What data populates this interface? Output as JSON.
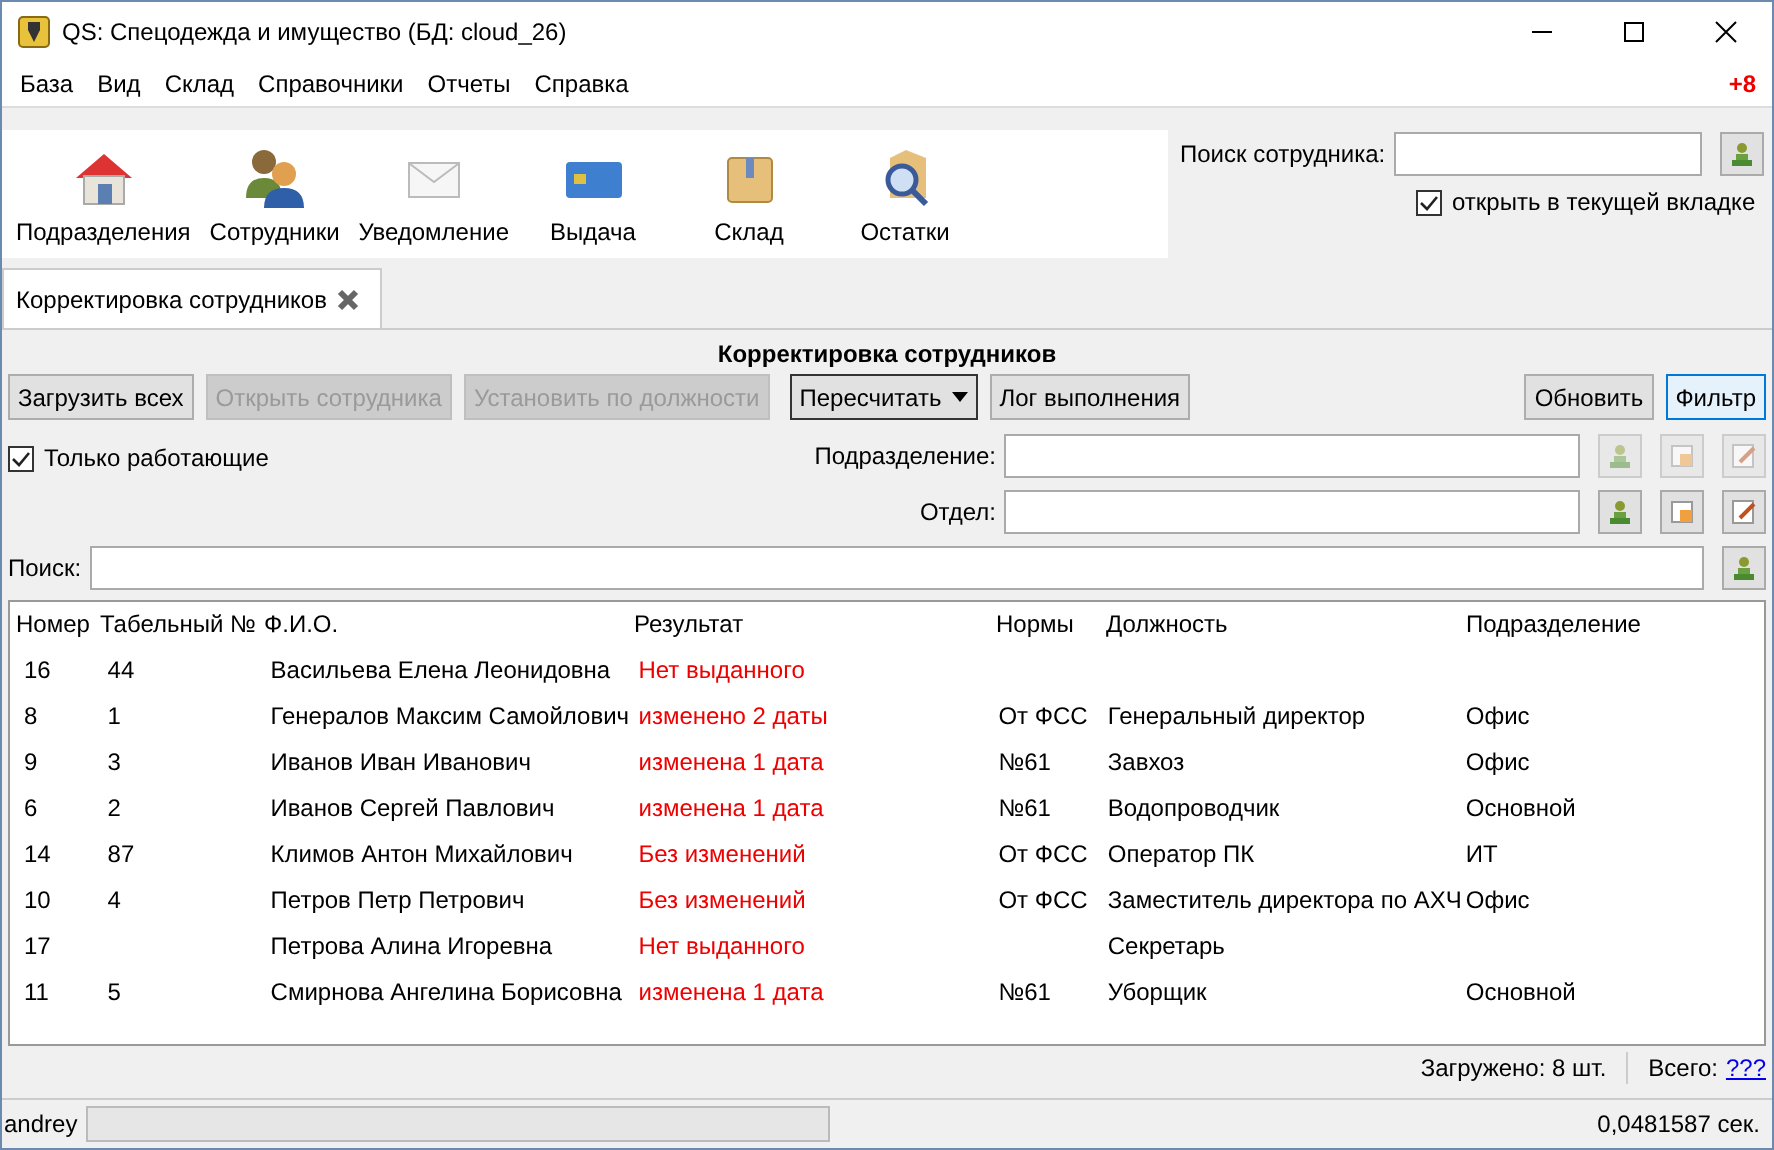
{
  "window": {
    "title": "QS: Спецодежда и имущество (БД: cloud_26)"
  },
  "menu": [
    "База",
    "Вид",
    "Склад",
    "Справочники",
    "Отчеты",
    "Справка"
  ],
  "notification_count": "+8",
  "toolbar": [
    {
      "kind": "house",
      "label": "Подразделения"
    },
    {
      "kind": "people",
      "label": "Сотрудники"
    },
    {
      "kind": "envelope",
      "label": "Уведомление"
    },
    {
      "kind": "card",
      "label": "Выдача"
    },
    {
      "kind": "box",
      "label": "Склад"
    },
    {
      "kind": "magnifier",
      "label": "Остатки"
    }
  ],
  "employee_search": {
    "label": "Поиск сотрудника:",
    "open_in_current_tab": {
      "label": "открыть в текущей вкладке",
      "checked": true
    }
  },
  "tabs": [
    {
      "label": "Корректировка сотрудников",
      "selected": true
    }
  ],
  "panel_title": "Корректировка сотрудников",
  "actions": [
    {
      "label": "Загрузить всех",
      "disabled": false,
      "kind": "plain"
    },
    {
      "label": "Открыть сотрудника",
      "disabled": true,
      "kind": "plain"
    },
    {
      "label": "Установить по должности",
      "disabled": true,
      "kind": "plain"
    },
    {
      "label": "Пересчитать",
      "disabled": false,
      "kind": "dropdown"
    },
    {
      "label": "Лог выполнения",
      "disabled": false,
      "kind": "plain"
    }
  ],
  "right_actions": [
    {
      "label": "Обновить",
      "selected": false
    },
    {
      "label": "Фильтр",
      "selected": true
    }
  ],
  "only_working": {
    "label": "Только работающие",
    "checked": true
  },
  "filters": [
    {
      "label": "Подразделение:",
      "disabled": true
    },
    {
      "label": "Отдел:",
      "disabled": false
    }
  ],
  "search": {
    "label": "Поиск:"
  },
  "table": {
    "columns": [
      "Номер",
      "Табельный №",
      "Ф.И.О.",
      "Результат",
      "Нормы",
      "Должность",
      "Подразделение"
    ],
    "rows": [
      [
        "16",
        "44",
        "Васильева Елена Леонидовна",
        "Нет выданного",
        "",
        "",
        ""
      ],
      [
        "8",
        "1",
        "Генералов Максим Самойлович",
        "изменено 2 даты",
        "От ФСС",
        "Генеральный директор",
        "Офис"
      ],
      [
        "9",
        "3",
        "Иванов Иван Иванович",
        "изменена 1 дата",
        "№61",
        "Завхоз",
        "Офис"
      ],
      [
        "6",
        "2",
        "Иванов Сергей Павлович",
        "изменена 1 дата",
        "№61",
        "Водопроводчик",
        "Основной"
      ],
      [
        "14",
        "87",
        "Климов Антон Михайлович",
        "Без изменений",
        "От ФСС",
        "Оператор ПК",
        "ИТ"
      ],
      [
        "10",
        "4",
        "Петров Петр Петрович",
        "Без изменений",
        "От ФСС",
        "Заместитель директора по АХЧ",
        "Офис"
      ],
      [
        "17",
        "",
        "Петрова Алина Игоревна",
        "Нет выданного",
        "",
        "Секретарь",
        ""
      ],
      [
        "11",
        "5",
        "Смирнова Ангелина Борисовна",
        "изменена 1 дата",
        "№61",
        "Уборщик",
        "Основной"
      ]
    ]
  },
  "summary": {
    "loaded": "Загружено: 8 шт.",
    "total_label": "Всего:",
    "total_link": "???"
  },
  "status_bar": {
    "user": "andrey",
    "elapsed": "0,0481587 сек."
  }
}
